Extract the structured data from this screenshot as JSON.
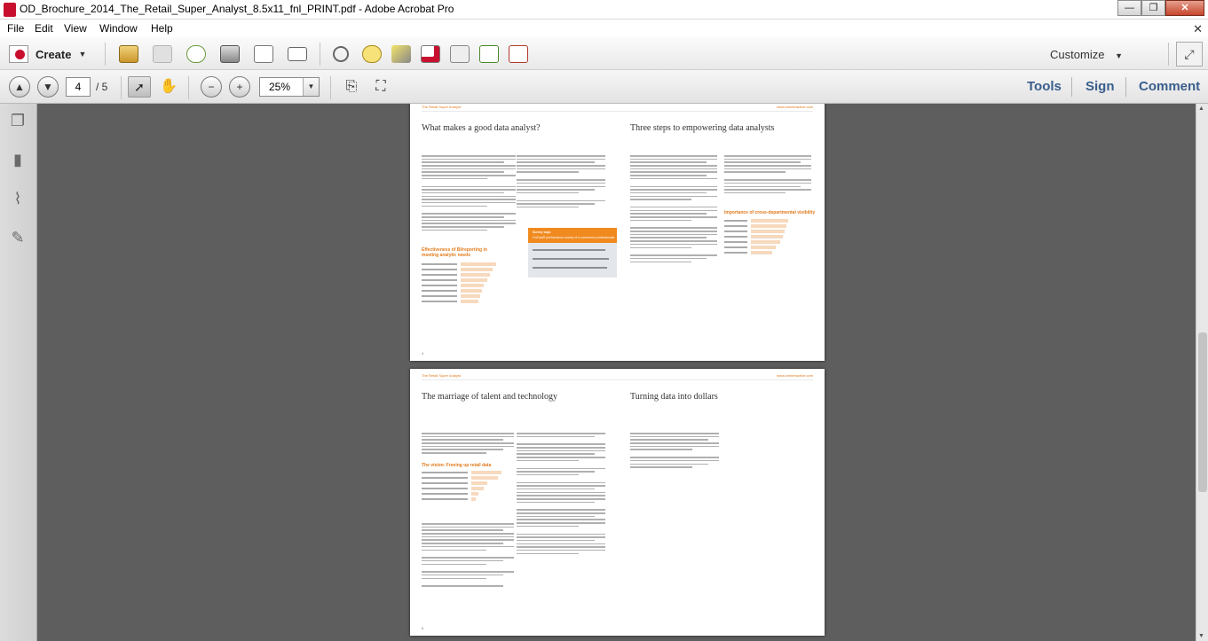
{
  "window": {
    "title": "OD_Brochure_2014_The_Retail_Super_Analyst_8.5x11_fnl_PRINT.pdf - Adobe Acrobat Pro",
    "minimize_glyph": "—",
    "restore_glyph": "❐",
    "close_glyph": "✕",
    "doc_close_glyph": "✕"
  },
  "menu": {
    "items": [
      "File",
      "Edit",
      "View",
      "Window",
      "Help"
    ]
  },
  "toolbar": {
    "create_label": "Create",
    "customize_label": "Customize",
    "icons": [
      "open-folder-icon",
      "save-icon",
      "upload-cloud-icon",
      "print-icon",
      "edit-form-icon",
      "email-icon",
      "gear-icon",
      "comment-bubble-icon",
      "highlight-icon",
      "redact-icon",
      "extract-icon",
      "export-icon",
      "share-icon"
    ]
  },
  "nav": {
    "current_page": "4",
    "total_pages": "/ 5",
    "zoom": "25%",
    "panes": [
      "Tools",
      "Sign",
      "Comment"
    ]
  },
  "colors": {
    "pane_link": "#3a5e8c",
    "accent_orange": "#e07a1c",
    "page_bg": "#5e5e5e"
  },
  "document": {
    "page1": {
      "header_left": "The Retail Super Analyst",
      "header_right": "www.oninteractive.com",
      "heading_left": "What makes a good data analyst?",
      "heading_right": "Three steps to empowering data analysts",
      "chart_left_title_1": "Effectiveness of BI/reporting in",
      "chart_left_title_2": "meeting analytic needs",
      "chart_right_title": "Importance of cross-departmental visibility",
      "callout_title": "Survey says",
      "callout_sub": "OnCast® performance survey of e-commerce professionals",
      "page_number": "4"
    },
    "page2": {
      "header_left": "The Retail Super Analyst",
      "header_right": "www.oninteractive.com",
      "heading_left": "The marriage of talent and technology",
      "heading_right": "Turning data into dollars",
      "chart_title": "The vision: Freeing up retail data",
      "page_number": "6"
    }
  }
}
